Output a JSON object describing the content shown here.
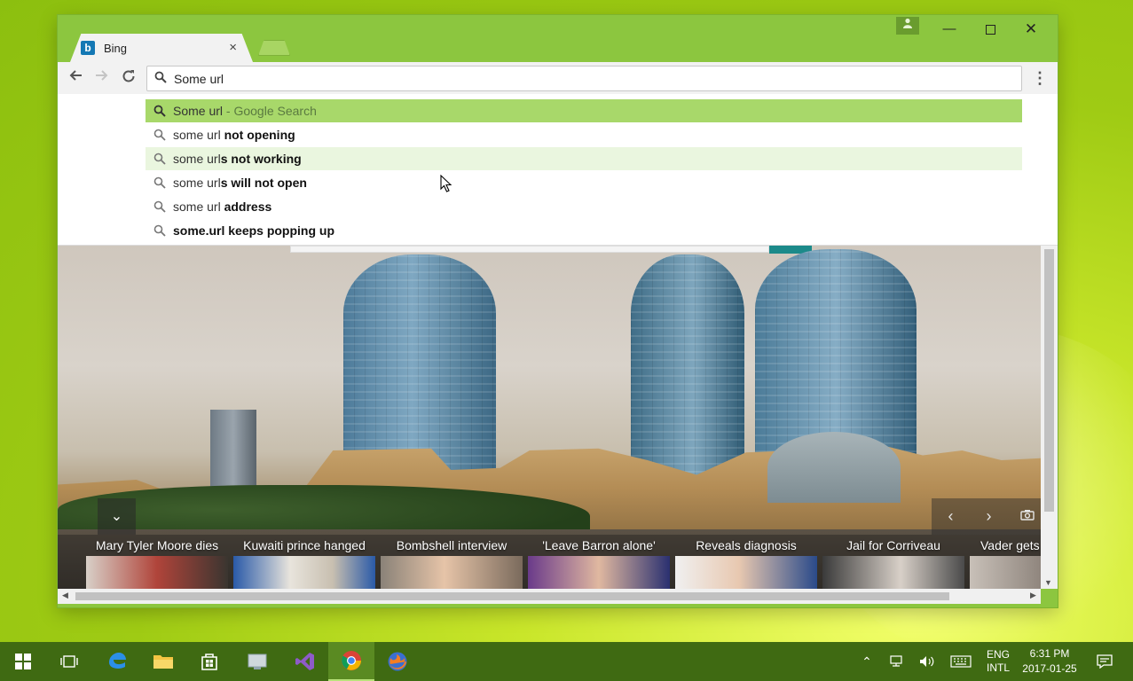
{
  "tab": {
    "title": "Bing",
    "favicon": "b",
    "close": "×"
  },
  "window_controls": {
    "minimize": "—",
    "close": "✕"
  },
  "omnibox": {
    "value": "Some url"
  },
  "suggestions": [
    {
      "pre": "Some url",
      "bold": "",
      "hint": " - Google Search"
    },
    {
      "pre": "some url",
      "bold": " not opening",
      "hint": ""
    },
    {
      "pre": "some url",
      "bold": "s not working",
      "hint": ""
    },
    {
      "pre": "some url",
      "bold": "s will not open",
      "hint": ""
    },
    {
      "pre": "some url",
      "bold": " address",
      "hint": ""
    },
    {
      "pre": "",
      "bold": "some.url keeps popping up",
      "hint": ""
    }
  ],
  "news": [
    "Mary Tyler Moore dies",
    "Kuwaiti prince hanged",
    "Bombshell interview",
    "'Leave Barron alone'",
    "Reveals diagnosis",
    "Jail for Corriveau",
    "Vader gets"
  ],
  "taskbar": {
    "lang_top": "ENG",
    "lang_bottom": "INTL",
    "time": "6:31 PM",
    "date": "2017-01-25"
  },
  "colors": {
    "frame": "#8cc63f",
    "suggestion_selected": "#a8d86a",
    "taskbar": "#3f6a12"
  },
  "icons": {
    "taskbar": [
      "windows-start-icon",
      "task-view-icon",
      "edge-icon",
      "file-explorer-icon",
      "store-icon",
      "app-icon",
      "visual-studio-icon",
      "chrome-icon",
      "firefox-icon"
    ]
  }
}
